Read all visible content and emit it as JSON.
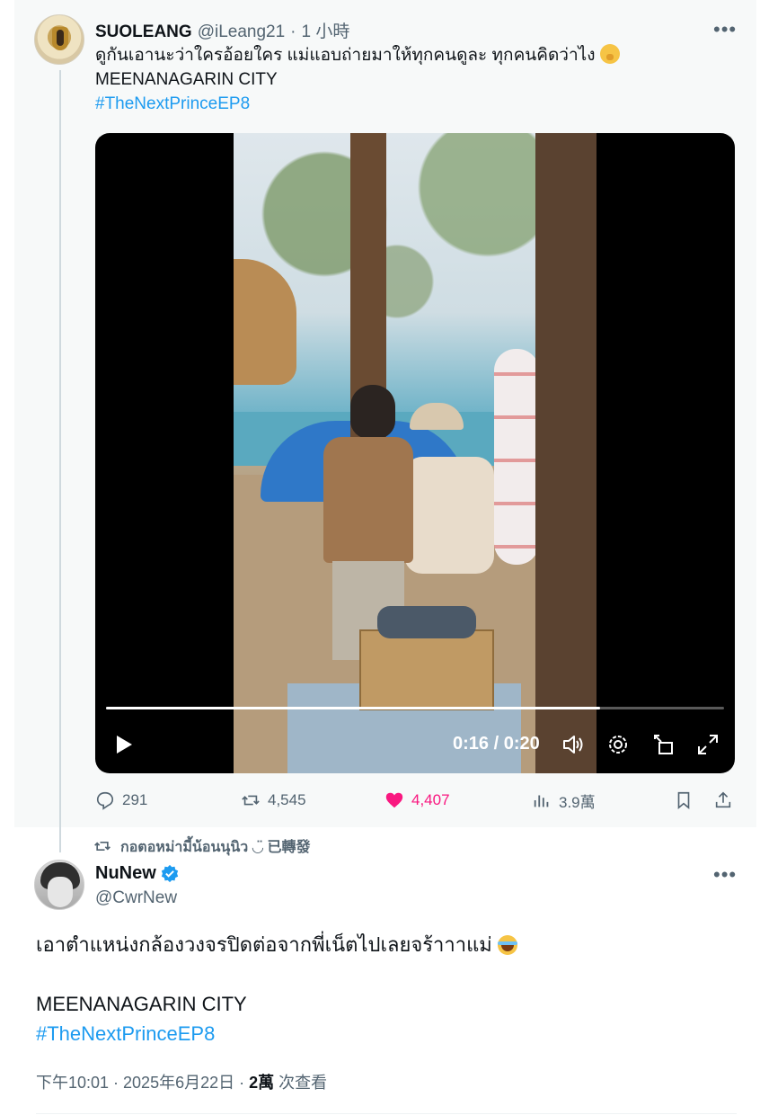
{
  "quoted_post": {
    "author_name": "SUOLEANG",
    "author_handle": "@iLeang21",
    "separator": "·",
    "time_ago": "1 小時",
    "more_label": "•••",
    "text_line1": "ดูกันเอานะว่าใครอ้อยใคร แม่แอบถ่ายมาให้ทุกคนดูละ ทุกคนคิดว่าไง",
    "emoji1": "shushing-face-emoji",
    "text_line2": "MEENANAGARIN CITY",
    "hashtag": "#TheNextPrinceEP8",
    "video": {
      "time_display": "0:16 / 0:20",
      "progress": 0.8,
      "controls": [
        "play-icon",
        "volume-icon",
        "settings-icon",
        "pip-icon",
        "fullscreen-icon"
      ]
    },
    "actions": {
      "replies": "291",
      "reposts": "4,545",
      "likes": "4,407",
      "views": "3.9萬"
    }
  },
  "repost_banner": {
    "text": "กอตอหม่ามี้น้อนนุนิว ◡̈ 已轉發"
  },
  "main_post": {
    "author_name": "NuNew",
    "verified": true,
    "author_handle": "@CwrNew",
    "more_label": "•••",
    "text_line1": "เอาตำแหน่งกล้องวงจรปิดต่อจากพี่เน็ตไปเลยจร้าาาแม่",
    "emoji": "face-with-tears-of-joy-emoji",
    "text_line2": "MEENANAGARIN CITY",
    "hashtag": "#TheNextPrinceEP8",
    "timestamp": "下午10:01 · 2025年6月22日 · ",
    "view_count": "2萬",
    "view_label": " 次查看"
  },
  "colors": {
    "link": "#1d9bf0",
    "like": "#f91880",
    "muted": "#536471",
    "verified": "#1d9bf0"
  }
}
